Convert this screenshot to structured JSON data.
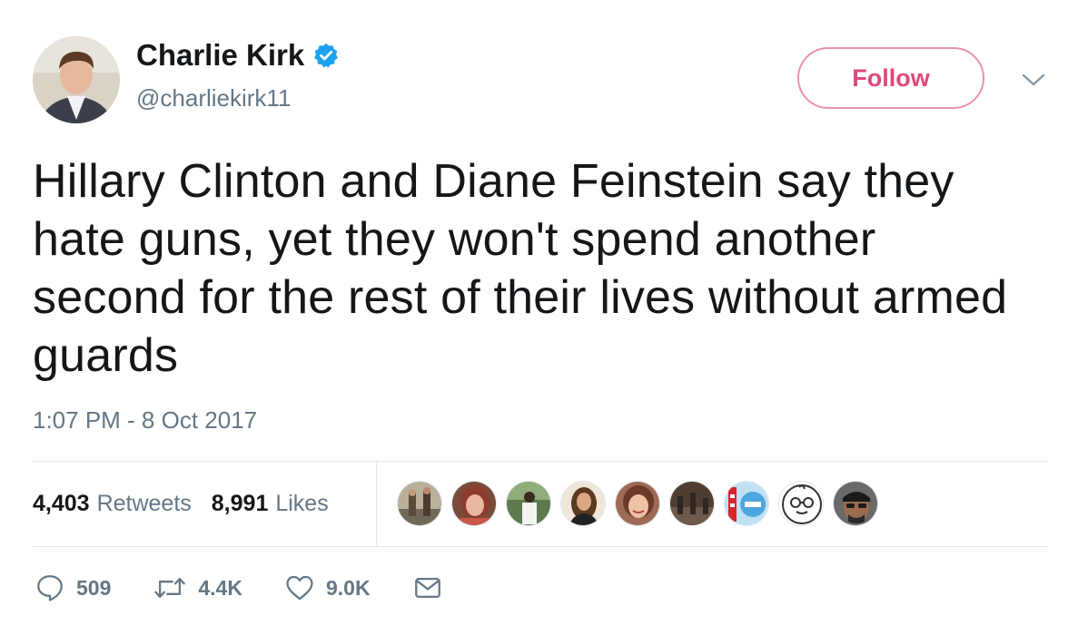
{
  "author": {
    "name": "Charlie Kirk",
    "handle": "@charliekirk11",
    "verified": true
  },
  "follow_label": "Follow",
  "tweet": {
    "text": "Hillary Clinton and Diane Feinstein say they hate guns, yet they won't spend another second for the rest of their lives without armed guards",
    "timestamp": "1:07 PM - 8 Oct 2017"
  },
  "stats": {
    "retweets_count": "4,403",
    "retweets_label": "Retweets",
    "likes_count": "8,991",
    "likes_label": "Likes"
  },
  "actions": {
    "replies": "509",
    "retweets": "4.4K",
    "likes": "9.0K"
  },
  "icons": {
    "verified": "verified-badge-icon",
    "caret": "chevron-down-icon",
    "reply": "reply-icon",
    "retweet": "retweet-icon",
    "like": "heart-icon",
    "message": "envelope-icon"
  },
  "colors": {
    "verified_blue": "#1da1f2",
    "follow_pink": "#e0477f",
    "follow_border": "#ec8fb6",
    "secondary_text": "#657786",
    "primary_text": "#14171a",
    "divider": "#e1e8ed"
  }
}
